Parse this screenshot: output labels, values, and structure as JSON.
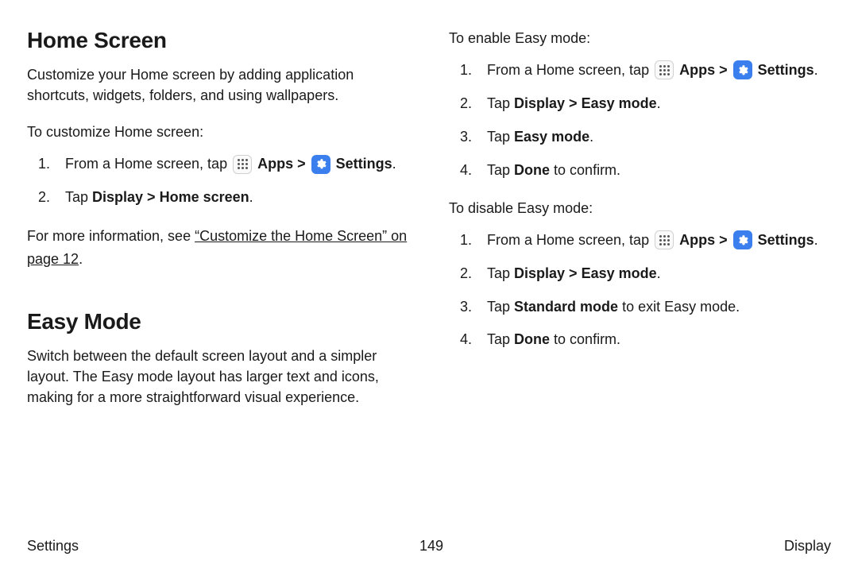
{
  "left": {
    "heading1": "Home Screen",
    "intro1": "Customize your Home screen by adding application shortcuts, widgets, folders, and using wallpapers.",
    "lead1": "To customize Home screen:",
    "step1_pre": "From a Home screen, tap ",
    "apps_label": "Apps",
    "settings_label": "Settings",
    "sep": " > ",
    "period": ".",
    "step2_pre": "Tap ",
    "step2_bold": "Display > Home screen",
    "more_pre": "For more information, see ",
    "more_link": "“Customize the Home Screen” on page 12",
    "heading2": "Easy Mode",
    "intro2": "Switch between the default screen layout and a simpler layout. The Easy mode layout has larger text and icons, making for a more straightforward visual experience."
  },
  "right": {
    "enable_lead": "To enable Easy mode:",
    "step1_pre": "From a Home screen, tap ",
    "apps_label": "Apps",
    "settings_label": "Settings",
    "sep": " > ",
    "period": ".",
    "e2_pre": "Tap ",
    "e2_bold": "Display > Easy mode",
    "e3_pre": "Tap ",
    "e3_bold": "Easy mode",
    "e4_pre": "Tap ",
    "e4_bold": "Done",
    "e4_post": " to confirm.",
    "disable_lead": "To disable Easy mode:",
    "d3_pre": "Tap ",
    "d3_bold": "Standard mode",
    "d3_post": " to exit Easy mode."
  },
  "footer": {
    "left": "Settings",
    "center": "149",
    "right": "Display"
  }
}
